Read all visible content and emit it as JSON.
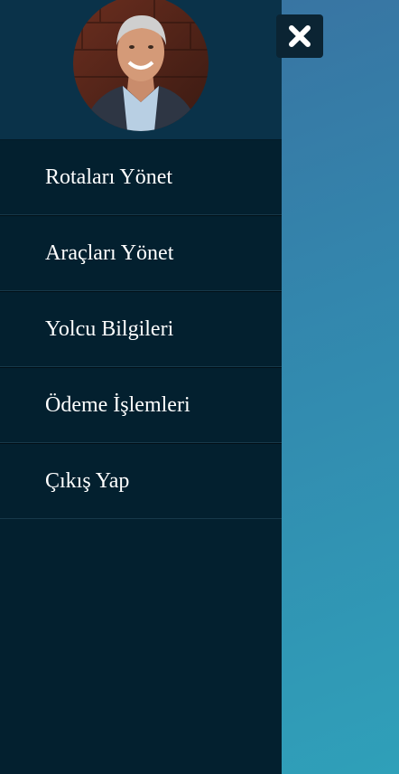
{
  "colors": {
    "drawer_bg": "#03202f",
    "profile_bg": "#0a3249",
    "background_top": "#3a6f9f",
    "background_bottom": "#2fa0b9",
    "text": "#ffffff"
  },
  "profile": {
    "avatar_icon": "user-photo"
  },
  "menu": {
    "items": [
      {
        "label": "Rotaları Yönet"
      },
      {
        "label": "Araçları Yönet"
      },
      {
        "label": "Yolcu Bilgileri"
      },
      {
        "label": "Ödeme İşlemleri"
      },
      {
        "label": "Çıkış Yap"
      }
    ]
  },
  "close_button": {
    "icon": "close-icon"
  }
}
